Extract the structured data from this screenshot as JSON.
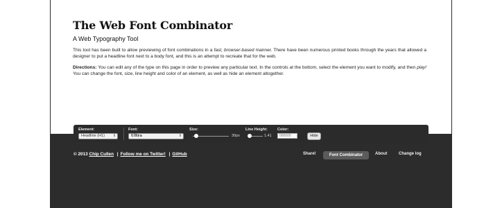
{
  "header": {
    "title": "The Web Font Combinator",
    "subtitle": "A Web Typography Tool"
  },
  "intro": {
    "part1": "This tool has been built to allow previewing of font combinations in a ",
    "em1": "fast, browser-based",
    "part2": " manner. There have been numerous printed books through the years that allowed a designer to put a headline font next to a body font, and this is an attempt to recreate that for the web."
  },
  "directions": {
    "label": "Directions:",
    "part1": " You can edit any of the type on this page in order to preview any particular text. In the controls at the bottom, select the element you want to modify, and then ",
    "em1": "play!",
    "part2": " You can change the font, size, line height and color of an element, as well as hide an element altogether."
  },
  "controls": {
    "element_label": "Element:",
    "element_value": "Headline (H1)",
    "font_label": "Font:",
    "font_value": "Ultra",
    "size_label": "Size:",
    "size_value": "30px",
    "size_level": 0.1,
    "line_height_label": "Line Height:",
    "line_height_value": "1.41",
    "line_height_level": 0.1,
    "color_label": "Color:",
    "color_placeholder": "000000",
    "hide_label": "Hide",
    "bar_color": "#2b2b2b"
  },
  "footer": {
    "copyright": "© 2013 ",
    "author": "Chip Cullen",
    "twitter": "Follow me on Twitter!",
    "github": "GitHub",
    "sep": "|",
    "nav": {
      "share": "Share!",
      "active": "Font Combinator",
      "about": "About",
      "changelog": "Change log"
    },
    "bg_color": "#2c2c2c"
  }
}
